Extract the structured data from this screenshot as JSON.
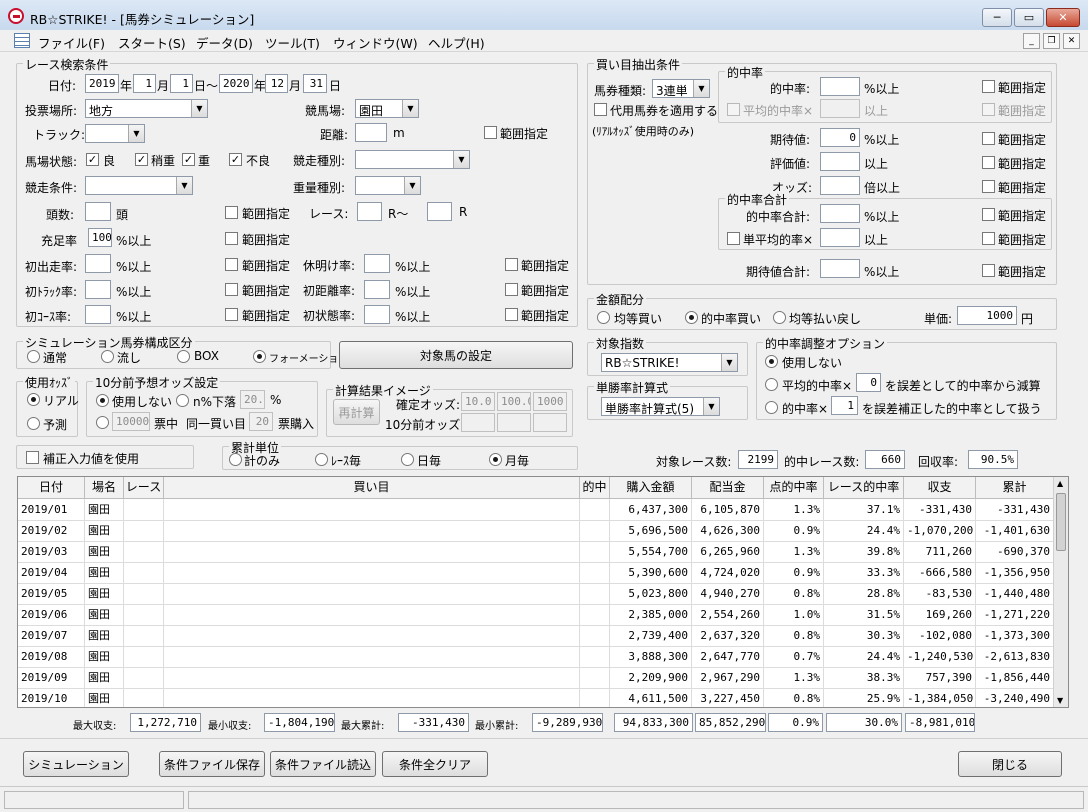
{
  "window": {
    "title": "RB☆STRIKE! - [馬券シミュレーション]"
  },
  "menu": [
    "ファイル(F)",
    "スタート(S)",
    "データ(D)",
    "ツール(T)",
    "ウィンドウ(W)",
    "ヘルプ(H)"
  ],
  "race_search": {
    "group_label": "レース検索条件",
    "date_label": "日付:",
    "from_year": "2019",
    "from_month": "1",
    "from_day": "1",
    "to_year": "2020",
    "to_month": "12",
    "to_day": "31",
    "year_unit": "年",
    "month_unit": "月",
    "day_unit_from": "日～",
    "day_unit_to": "日",
    "venue_type_label": "投票場所:",
    "venue_type_value": "地方",
    "course_label": "競馬場:",
    "course_value": "園田",
    "track_label": "トラック:",
    "distance_label": "距離:",
    "distance_unit": "m",
    "range_label": "範囲指定",
    "condition_label": "馬場状態:",
    "cond_good": "良",
    "cond_slightly_heavy": "稍重",
    "cond_heavy": "重",
    "cond_bad": "不良",
    "race_type_label": "競走種別:",
    "race_cond_label": "競走条件:",
    "weight_type_label": "重量種別:",
    "heads_label": "頭数:",
    "heads_unit": "頭",
    "race_label": "レース:",
    "race_from_unit": "R～",
    "race_to_unit": "R",
    "fill_rate_label": "充足率",
    "fill_rate_value": "100",
    "pct_above": "%以上",
    "debut_rate_label": "初出走率:",
    "rest_rate_label": "休明け率:",
    "first_track_label": "初ﾄﾗｯｸ率:",
    "first_distance_label": "初距離率:",
    "first_course_label": "初ｺｰｽ率:",
    "first_state_label": "初状態率:"
  },
  "composition": {
    "group_label": "シミュレーション馬券構成区分",
    "options": [
      "通常",
      "流し",
      "BOX",
      "フォーメーション"
    ],
    "target_horse_button": "対象馬の設定"
  },
  "odds_used": {
    "group_label": "使用ｵｯｽﾞ",
    "real": "リアル",
    "forecast": "予測"
  },
  "odds10": {
    "group_label": "10分前予想オッズ設定",
    "not_use": "使用しない",
    "n_drop": "n%下落",
    "n_value": "20.0",
    "pct": "%",
    "votes_value": "10000",
    "votes_mid": "票中",
    "same_buy": "同一買い目",
    "same_value": "20",
    "votes_buy": "票購入"
  },
  "calc_image": {
    "group_label": "計算結果イメージ",
    "recalc": "再計算",
    "confirmed_label": "確定オッズ:",
    "confirmed_values": [
      "10.0",
      "100.0",
      "1000"
    ],
    "ten_label": "10分前オッズ:"
  },
  "correction": {
    "label": "補正入力値を使用"
  },
  "aggregate": {
    "group_label": "累計単位",
    "options": [
      "計のみ",
      "ﾚｰｽ毎",
      "日毎",
      "月毎"
    ]
  },
  "buy_extract": {
    "group_label": "買い目抽出条件",
    "ticket_type_label": "馬券種類:",
    "ticket_type_value": "3連単",
    "proxy_label": "代用馬券を適用する",
    "proxy_note": "(ﾘｱﾙｵｯｽﾞ使用時のみ)",
    "hit_rate_group": "的中率",
    "hit_rate_label": "的中率:",
    "avg_hit_label": "平均的中率×",
    "pct_above": "%以上",
    "above": "以上",
    "expect_label": "期待値:",
    "expect_value": "0",
    "eval_label": "評価値:",
    "odds_label": "オッズ:",
    "odds_unit": "倍以上",
    "hit_sum_group": "的中率合計",
    "hit_sum_label": "的中率合計:",
    "single_avg_label": "単平均的率×",
    "expect_sum_label": "期待値合計:",
    "range_label": "範囲指定"
  },
  "money": {
    "group_label": "金額配分",
    "options": [
      "均等買い",
      "的中率買い",
      "均等払い戻し"
    ],
    "unit_label": "単価:",
    "unit_value": "1000",
    "unit_yen": "円"
  },
  "target_index": {
    "group_label": "対象指数",
    "value": "RB☆STRIKE!"
  },
  "win_rate_calc": {
    "group_label": "単勝率計算式",
    "value": "単勝率計算式(5)"
  },
  "hit_adjust": {
    "group_label": "的中率調整オプション",
    "opt_none": "使用しない",
    "opt_avg_pre": "平均的中率×",
    "opt_avg_value": "0",
    "opt_avg_post": "を誤差として的中率から減算",
    "opt_hit_pre": "的中率×",
    "opt_hit_value": "1",
    "opt_hit_post": "を誤差補正した的中率として扱う"
  },
  "summary": {
    "target_races_label": "対象レース数:",
    "target_races": "2199",
    "hit_races_label": "的中レース数:",
    "hit_races": "660",
    "recovery_label": "回収率:",
    "recovery": "90.5%"
  },
  "table": {
    "headers": [
      "日付",
      "場名",
      "レース",
      "買い目",
      "的中",
      "購入金額",
      "配当金",
      "点的中率",
      "レース的中率",
      "収支",
      "累計"
    ],
    "rows": [
      [
        "2019/01",
        "園田",
        "",
        "",
        "",
        "6,437,300",
        "6,105,870",
        "1.3%",
        "37.1%",
        "-331,430",
        "-331,430"
      ],
      [
        "2019/02",
        "園田",
        "",
        "",
        "",
        "5,696,500",
        "4,626,300",
        "0.9%",
        "24.4%",
        "-1,070,200",
        "-1,401,630"
      ],
      [
        "2019/03",
        "園田",
        "",
        "",
        "",
        "5,554,700",
        "6,265,960",
        "1.3%",
        "39.8%",
        "711,260",
        "-690,370"
      ],
      [
        "2019/04",
        "園田",
        "",
        "",
        "",
        "5,390,600",
        "4,724,020",
        "0.9%",
        "33.3%",
        "-666,580",
        "-1,356,950"
      ],
      [
        "2019/05",
        "園田",
        "",
        "",
        "",
        "5,023,800",
        "4,940,270",
        "0.8%",
        "28.8%",
        "-83,530",
        "-1,440,480"
      ],
      [
        "2019/06",
        "園田",
        "",
        "",
        "",
        "2,385,000",
        "2,554,260",
        "1.0%",
        "31.5%",
        "169,260",
        "-1,271,220"
      ],
      [
        "2019/07",
        "園田",
        "",
        "",
        "",
        "2,739,400",
        "2,637,320",
        "0.8%",
        "30.3%",
        "-102,080",
        "-1,373,300"
      ],
      [
        "2019/08",
        "園田",
        "",
        "",
        "",
        "3,888,300",
        "2,647,770",
        "0.7%",
        "24.4%",
        "-1,240,530",
        "-2,613,830"
      ],
      [
        "2019/09",
        "園田",
        "",
        "",
        "",
        "2,209,900",
        "2,967,290",
        "1.3%",
        "38.3%",
        "757,390",
        "-1,856,440"
      ],
      [
        "2019/10",
        "園田",
        "",
        "",
        "",
        "4,611,500",
        "3,227,450",
        "0.8%",
        "25.9%",
        "-1,384,050",
        "-3,240,490"
      ]
    ]
  },
  "totals": {
    "max_income_label": "最大収支:",
    "max_income": "1,272,710",
    "min_income_label": "最小収支:",
    "min_income": "-1,804,190",
    "max_cum_label": "最大累計:",
    "max_cum": "-331,430",
    "min_cum_label": "最小累計:",
    "min_cum": "-9,289,930",
    "purchase": "94,833,300",
    "payout": "85,852,290",
    "point_hit": "0.9%",
    "race_hit": "30.0%",
    "balance": "-8,981,010"
  },
  "buttons": {
    "simulate": "シミュレーション",
    "save": "条件ファイル保存",
    "load": "条件ファイル読込",
    "clear": "条件全クリア",
    "close": "閉じる"
  }
}
